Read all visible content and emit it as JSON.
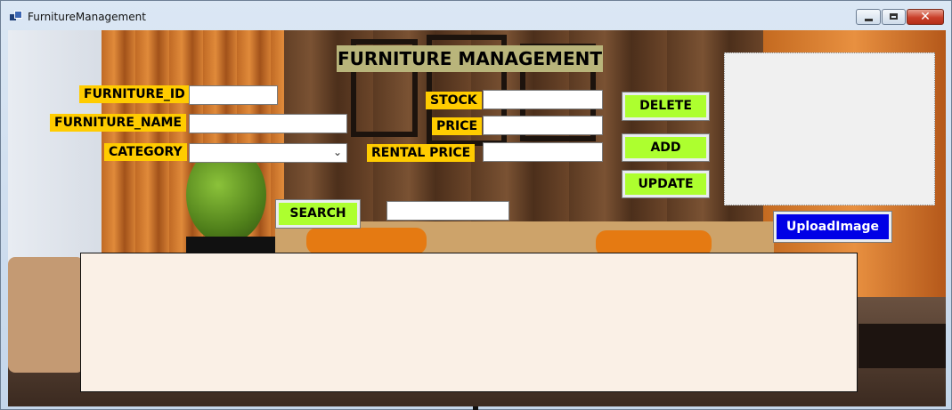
{
  "window": {
    "title": "FurnitureManagement",
    "close_glyph": "✕"
  },
  "form": {
    "heading": "FURNITURE MANAGEMENT",
    "labels": {
      "furniture_id": "FURNITURE_ID",
      "furniture_name": "FURNITURE_NAME",
      "category": "CATEGORY",
      "stock": "STOCK",
      "price": "PRICE",
      "rental_price": "RENTAL PRICE"
    },
    "values": {
      "furniture_id": "",
      "furniture_name": "",
      "category": "",
      "stock": "",
      "price": "",
      "rental_price": "",
      "search": ""
    },
    "buttons": {
      "delete": "DELETE",
      "add": "ADD",
      "update": "UPDATE",
      "search": "SEARCH",
      "upload_image": "UploadImage"
    },
    "combo_arrow": "⌄"
  },
  "colors": {
    "label_bg": "#ffcc00",
    "action_button_bg": "#adff2f",
    "upload_button_bg": "#0000e6",
    "heading_bg": "#b9b57b",
    "grid_bg": "#faf0e6",
    "picture_bg": "#f0f0f0"
  },
  "icons": {
    "app": "app-window-icon",
    "minimize": "minimize-icon",
    "maximize": "maximize-icon",
    "close": "close-icon",
    "dropdown": "chevron-down-icon"
  }
}
